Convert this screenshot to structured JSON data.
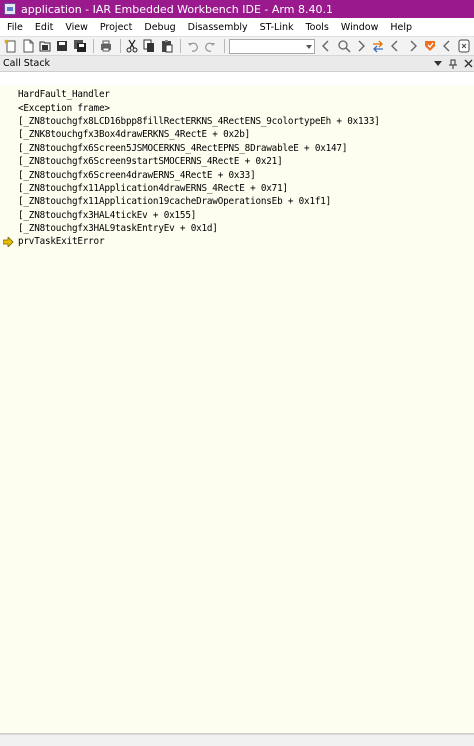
{
  "window": {
    "title": "application - IAR Embedded Workbench IDE - Arm 8.40.1"
  },
  "menu": {
    "items": [
      {
        "label": "File"
      },
      {
        "label": "Edit"
      },
      {
        "label": "View"
      },
      {
        "label": "Project"
      },
      {
        "label": "Debug"
      },
      {
        "label": "Disassembly"
      },
      {
        "label": "ST-Link"
      },
      {
        "label": "Tools"
      },
      {
        "label": "Window"
      },
      {
        "label": "Help"
      }
    ]
  },
  "toolbar": {
    "combo_value": ""
  },
  "call_stack": {
    "panel_title": "Call Stack",
    "frames": [
      {
        "text": "HardFault_Handler",
        "current": false
      },
      {
        "text": "<Exception frame>",
        "current": false
      },
      {
        "text": "[_ZN8touchgfx8LCD16bpp8fillRectERKNS_4RectENS_9colortypeEh + 0x133]",
        "current": false
      },
      {
        "text": "[_ZNK8touchgfx3Box4drawERKNS_4RectE + 0x2b]",
        "current": false
      },
      {
        "text": "[_ZN8touchgfx6Screen5JSMOCERKNS_4RectEPNS_8DrawableE + 0x147]",
        "current": false
      },
      {
        "text": "[_ZN8touchgfx6Screen9startSMOCERNS_4RectE + 0x21]",
        "current": false
      },
      {
        "text": "[_ZN8touchgfx6Screen4drawERNS_4RectE + 0x33]",
        "current": false
      },
      {
        "text": "[_ZN8touchgfx11Application4drawERNS_4RectE + 0x71]",
        "current": false
      },
      {
        "text": "[_ZN8touchgfx11Application19cacheDrawOperationsEb + 0x1f1]",
        "current": false
      },
      {
        "text": "[_ZN8touchgfx3HAL4tickEv + 0x155]",
        "current": false
      },
      {
        "text": "[_ZN8touchgfx3HAL9taskEntryEv + 0x1d]",
        "current": false
      },
      {
        "text": "prvTaskExitError",
        "current": true
      }
    ]
  },
  "colors": {
    "titlebar": "#9a1a8e",
    "panel_background": "#fdfdf0",
    "current_frame_arrow": "#e8c000"
  }
}
